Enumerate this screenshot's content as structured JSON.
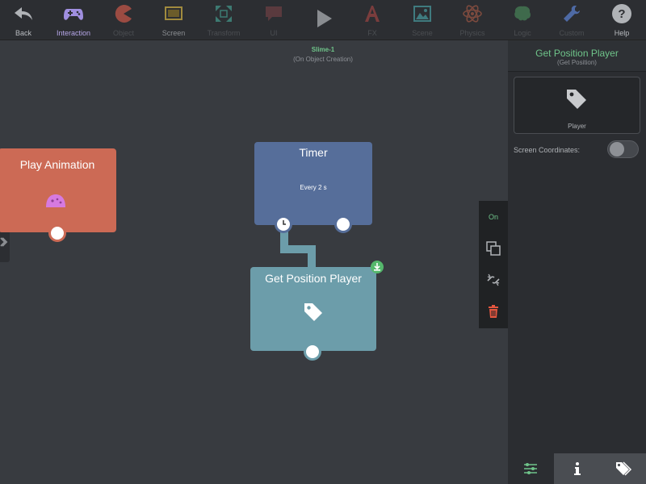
{
  "toolbar": {
    "items": [
      {
        "label": "Back",
        "icon": "back-arrow-icon"
      },
      {
        "label": "Interaction",
        "icon": "gamepad-icon"
      },
      {
        "label": "Object",
        "icon": "pacman-icon"
      },
      {
        "label": "Screen",
        "icon": "screen-icon"
      },
      {
        "label": "Transform",
        "icon": "transform-icon"
      },
      {
        "label": "UI",
        "icon": "speech-bubble-icon"
      },
      {
        "label": "",
        "icon": "play-icon"
      },
      {
        "label": "FX",
        "icon": "fx-icon"
      },
      {
        "label": "Scene",
        "icon": "landscape-icon"
      },
      {
        "label": "Physics",
        "icon": "atom-icon"
      },
      {
        "label": "Logic",
        "icon": "brain-icon"
      },
      {
        "label": "Custom",
        "icon": "wrench-icon"
      },
      {
        "label": "Help",
        "icon": "help-icon"
      }
    ]
  },
  "canvas": {
    "object_name": "Slime-1",
    "object_event": "(On Object Creation)"
  },
  "nodes": {
    "play_animation": {
      "title": "Play Animation",
      "icon": "slime-icon"
    },
    "timer": {
      "title": "Timer",
      "subtitle": "Every 2 s",
      "icon": "clock-icon"
    },
    "get_position": {
      "title": "Get Position Player",
      "icon": "tag-icon"
    }
  },
  "side_tools": {
    "on_label": "On"
  },
  "panel": {
    "title": "Get Position Player",
    "subtitle": "(Get Position)",
    "card_label": "Player",
    "screen_coordinates_label": "Screen Coordinates:",
    "screen_coordinates_on": false
  },
  "colors": {
    "accent_green": "#6fc48a",
    "play_node": "#cc6a55",
    "timer_node": "#566e9a",
    "getpos_node": "#6c9daa",
    "delete_red": "#e4563f"
  }
}
